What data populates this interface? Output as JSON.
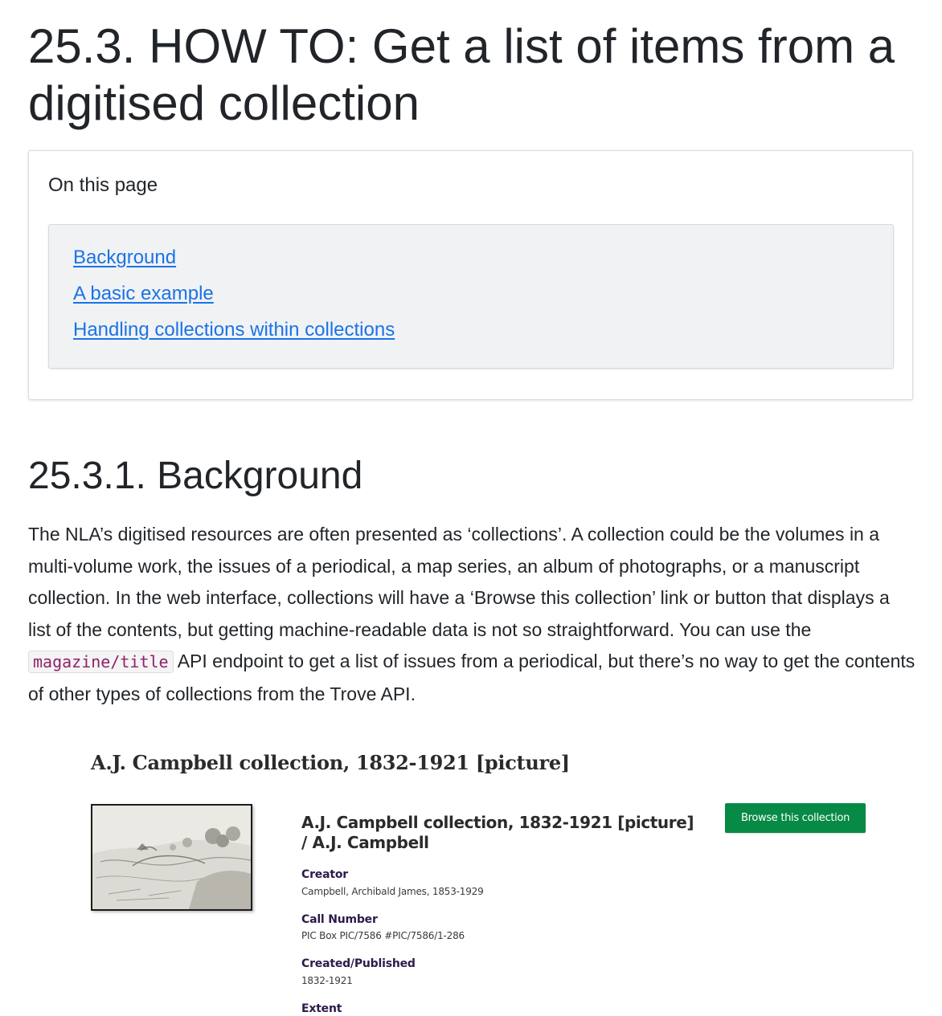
{
  "page_title": "25.3. HOW TO: Get a list of items from a digitised collection",
  "toc": {
    "heading": "On this page",
    "links": [
      {
        "label": "Background"
      },
      {
        "label": "A basic example"
      },
      {
        "label": "Handling collections within collections"
      }
    ]
  },
  "section": {
    "heading": "25.3.1. Background",
    "paragraph": {
      "text_before_code": "The NLA’s digitised resources are often presented as ‘collections’. A collection could be the volumes in a multi-volume work, the issues of a periodical, a map series, an album of photographs, or a manuscript collection. In the web interface, collections will have a ‘Browse this collection’ link or button that displays a list of the contents, but getting machine-readable data is not so straightforward. You can use the ",
      "code": "magazine/title",
      "text_after_code": " API endpoint to get a list of issues from a periodical, but there’s no way to get the contents of other types of collections from the Trove API."
    }
  },
  "screenshot": {
    "page_title": "A.J. Campbell collection, 1832-1921 [picture]",
    "record_title": "A.J. Campbell collection, 1832-1921 [picture] / A.J. Campbell",
    "browse_button": "Browse this collection",
    "thumbnail_icon": "sketch-thumbnail-image",
    "fields": [
      {
        "label": "Creator",
        "value": "Campbell, Archibald James, 1853-1929"
      },
      {
        "label": "Call Number",
        "value": "PIC Box PIC/7586 #PIC/7586/1-286"
      },
      {
        "label": "Created/Published",
        "value": "1832-1921"
      },
      {
        "label": "Extent",
        "value": ""
      }
    ],
    "colors": {
      "button": "#078a45",
      "field_label": "#2d1a4a"
    }
  },
  "colors": {
    "link": "#1a73e8",
    "code_text": "#8e236a",
    "text": "#212529"
  }
}
